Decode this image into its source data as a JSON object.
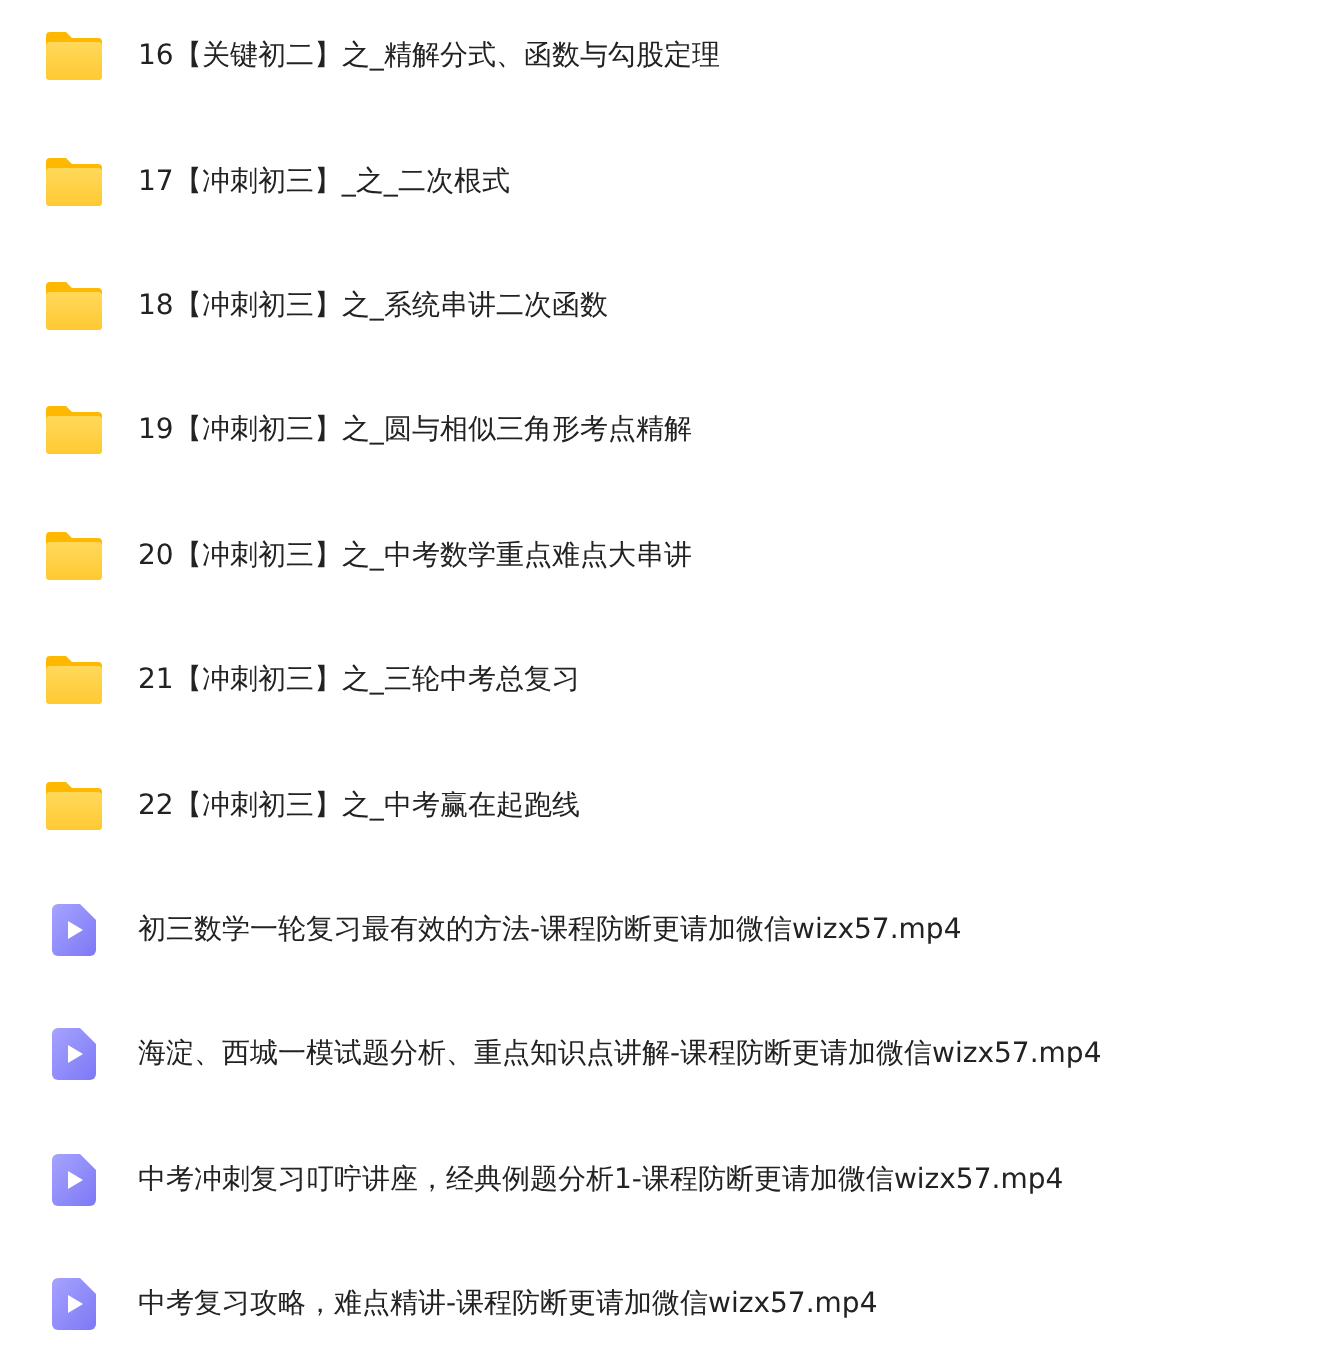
{
  "files": [
    {
      "kind": "folder",
      "name": "16【关键初二】之_精解分式、函数与勾股定理"
    },
    {
      "kind": "folder",
      "name": "17【冲刺初三】_之_二次根式"
    },
    {
      "kind": "folder",
      "name": "18【冲刺初三】之_系统串讲二次函数"
    },
    {
      "kind": "folder",
      "name": "19【冲刺初三】之_圆与相似三角形考点精解"
    },
    {
      "kind": "folder",
      "name": "20【冲刺初三】之_中考数学重点难点大串讲"
    },
    {
      "kind": "folder",
      "name": "21【冲刺初三】之_三轮中考总复习"
    },
    {
      "kind": "folder",
      "name": "22【冲刺初三】之_中考赢在起跑线"
    },
    {
      "kind": "video",
      "name": "初三数学一轮复习最有效的方法-课程防断更请加微信wizx57.mp4"
    },
    {
      "kind": "video",
      "name": "海淀、西城一模试题分析、重点知识点讲解-课程防断更请加微信wizx57.mp4"
    },
    {
      "kind": "video",
      "name": "中考冲刺复习叮咛讲座，经典例题分析1-课程防断更请加微信wizx57.mp4"
    },
    {
      "kind": "video",
      "name": "中考复习攻略，难点精讲-课程防断更请加微信wizx57.mp4"
    }
  ]
}
